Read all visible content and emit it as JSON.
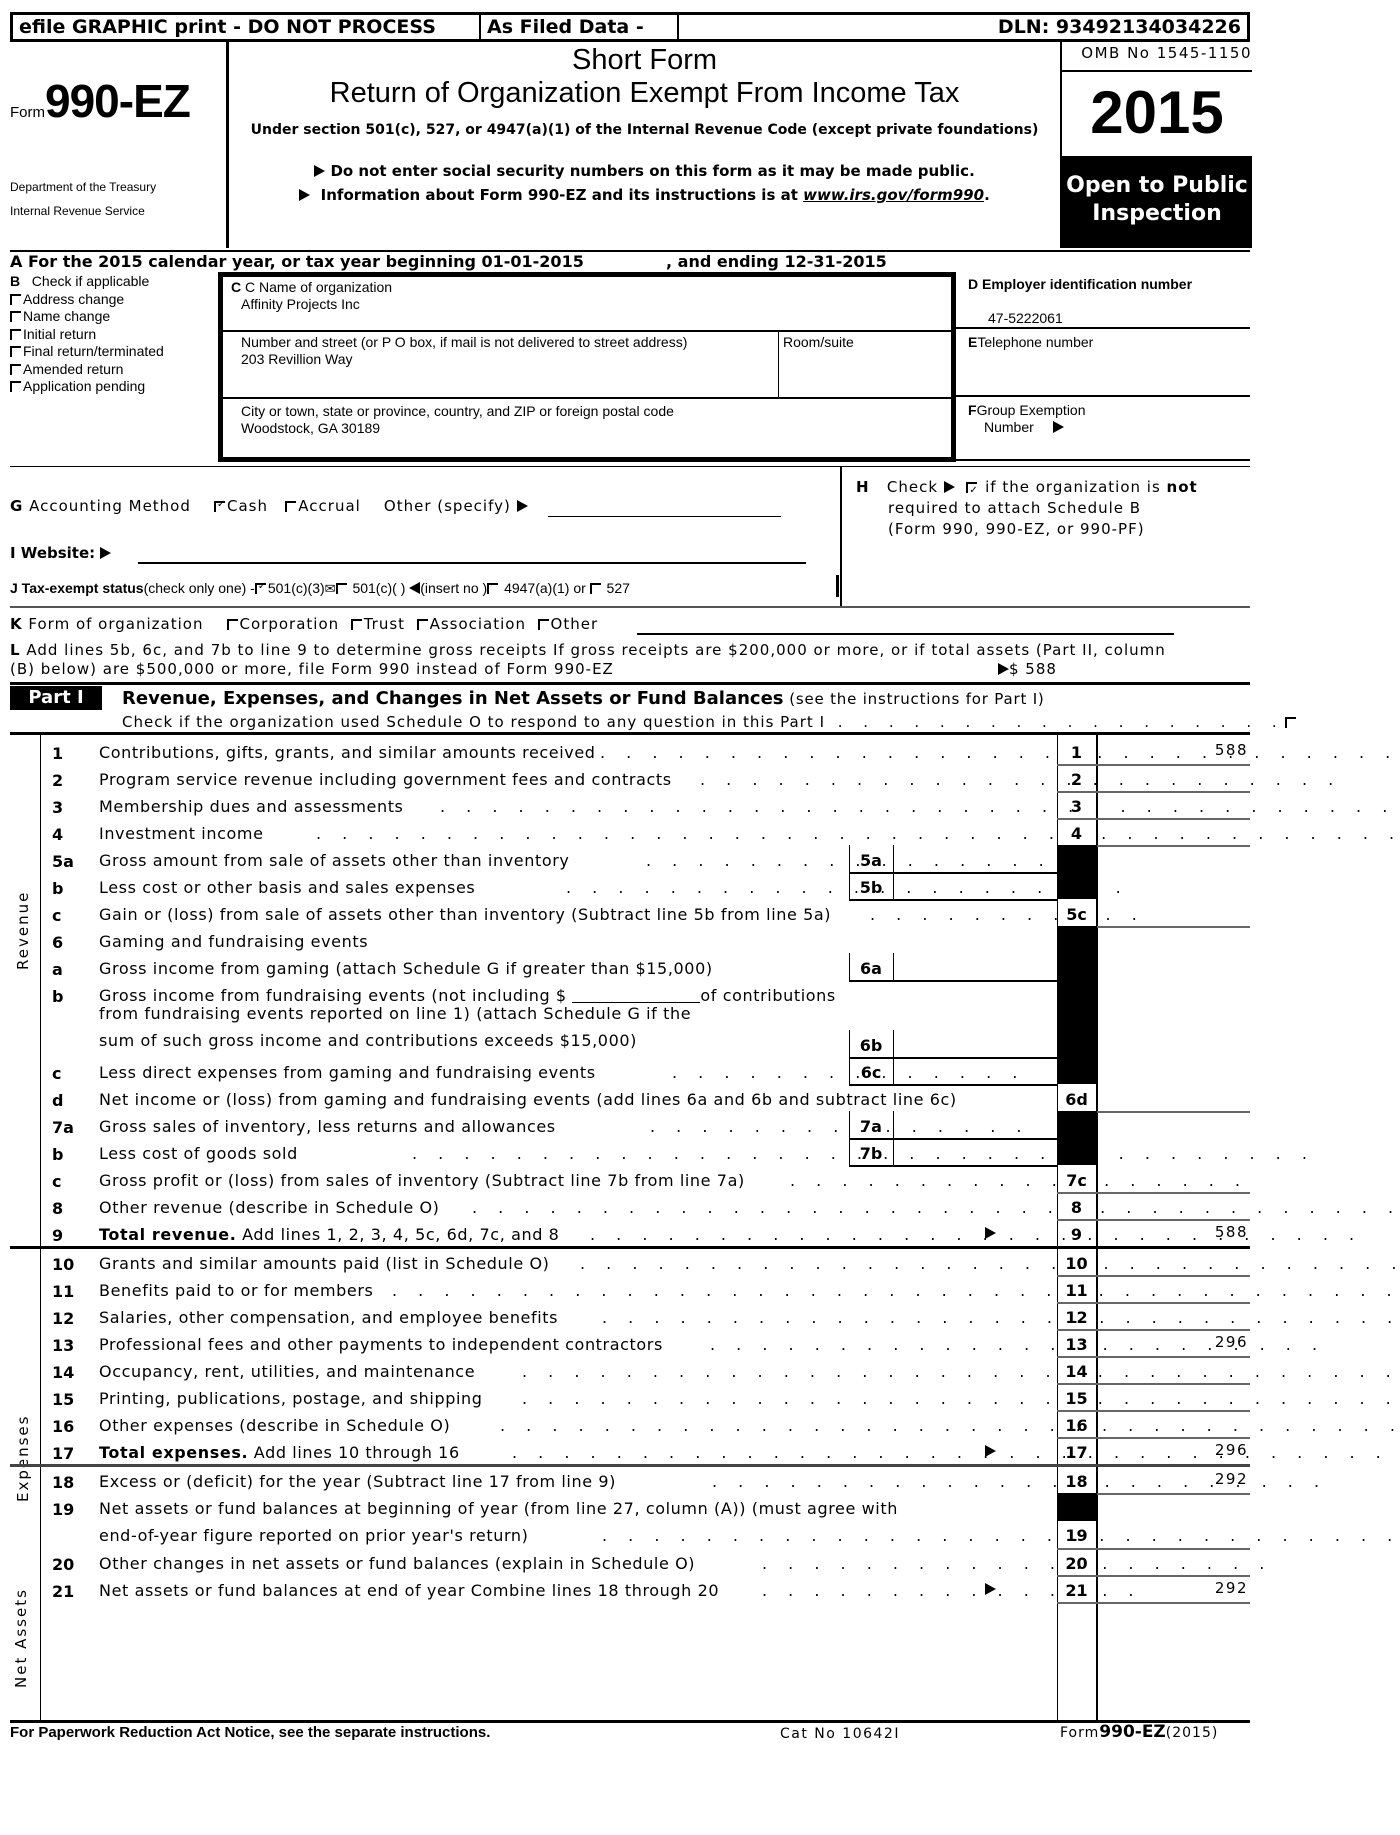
{
  "banner": {
    "efile": "efile GRAPHIC print - DO NOT PROCESS",
    "as_filed": "As Filed Data -",
    "dln": "DLN: 93492134034226"
  },
  "header": {
    "form_prefix": "Form",
    "form_number": "990-EZ",
    "dept1": "Department of the Treasury",
    "dept2": "Internal Revenue Service",
    "short_form": "Short Form",
    "title": "Return of Organization Exempt From Income Tax",
    "subtitle": "Under section 501(c), 527, or 4947(a)(1) of the Internal Revenue Code (except private foundations)",
    "notice1": "Do not enter social security numbers on this form as it may be made public.",
    "notice2_prefix": "Information about Form 990-EZ and its instructions is at ",
    "notice2_link": "www.irs.gov/form990",
    "notice2_suffix": ".",
    "omb": "OMB No 1545-1150",
    "year": "2015",
    "open_public_1": "Open to Public",
    "open_public_2": "Inspection"
  },
  "section_a": {
    "text": "A  For the 2015 calendar year, or tax year beginning 01-01-2015",
    "ending": ", and ending 12-31-2015"
  },
  "section_b": {
    "title_letter": "B",
    "title": "Check if applicable",
    "items": [
      {
        "label": "Address change",
        "checked": false
      },
      {
        "label": "Name change",
        "checked": false
      },
      {
        "label": "Initial return",
        "checked": false
      },
      {
        "label": "Final return/terminated",
        "checked": false
      },
      {
        "label": "Amended return",
        "checked": false
      },
      {
        "label": "Application pending",
        "checked": false
      }
    ]
  },
  "section_c": {
    "name_label": "C Name of organization",
    "name_value": "Affinity Projects Inc",
    "street_label": "Number and street (or P  O  box, if mail is not delivered to street address)",
    "room_label": "Room/suite",
    "street_value": "203 Revillion Way",
    "city_label": "City or town, state or province, country, and ZIP or foreign postal code",
    "city_value": "Woodstock, GA  30189"
  },
  "section_d": {
    "label": "D Employer identification number",
    "value": "47-5222061"
  },
  "section_e": {
    "letter": "E",
    "label": "Telephone number",
    "value": ""
  },
  "section_f": {
    "letter": "F",
    "label1": "Group Exemption",
    "label2": "Number",
    "value": ""
  },
  "section_g": {
    "letter": "G",
    "label": "Accounting Method",
    "cash": "Cash",
    "cash_checked": true,
    "accrual": "Accrual",
    "accrual_checked": false,
    "other": "Other (specify)"
  },
  "section_h": {
    "letter": "H",
    "check": "Check",
    "text1": "if the organization is ",
    "text1_bold": "not",
    "text2": "required to attach Schedule B",
    "text3": "(Form 990, 990-EZ, or 990-PF)",
    "checked": true
  },
  "section_i": {
    "label": "I Website:",
    "value": ""
  },
  "section_j": {
    "label": "J Tax-exempt status",
    "hint": "(check only one) -",
    "opt1": "501(c)(3)",
    "opt2": "501(c)(  )",
    "insert": "(insert no )",
    "opt3": "4947(a)(1) or",
    "opt4": "527"
  },
  "section_k": {
    "letter": "K",
    "label": "Form of organization",
    "options": [
      "Corporation",
      "Trust",
      "Association",
      "Other"
    ]
  },
  "section_l": {
    "letter": "L",
    "text1": "Add lines 5b, 6c, and 7b to line 9 to determine gross receipts  If gross receipts are $200,000 or more, or if total assets (Part II, column",
    "text2": "(B) below) are $500,000 or more, file Form 990 instead of Form 990-EZ",
    "amount": "$ 588"
  },
  "part1": {
    "badge": "Part I",
    "title": "Revenue, Expenses, and Changes in Net Assets or Fund Balances",
    "title_note": "(see the instructions for Part I)",
    "check_text": "Check if the organization used Schedule O to respond to any question in this Part I",
    "side_labels": {
      "revenue": "Revenue",
      "expenses": "Expenses",
      "net_assets": "Net Assets"
    },
    "lines": {
      "l1": {
        "num": "1",
        "label": "Contributions, gifts, grants, and similar amounts received",
        "box": "1",
        "amount": "588"
      },
      "l2": {
        "num": "2",
        "label": "Program service revenue including government fees and contracts",
        "box": "2",
        "amount": ""
      },
      "l3": {
        "num": "3",
        "label": "Membership dues and assessments",
        "box": "3",
        "amount": ""
      },
      "l4": {
        "num": "4",
        "label": "Investment income",
        "box": "4",
        "amount": ""
      },
      "l5a": {
        "num": "5a",
        "label": "Gross amount from sale of assets other than inventory",
        "box": "5a",
        "amount": ""
      },
      "l5b": {
        "num": "b",
        "label": "Less  cost or other basis and sales expenses",
        "box": "5b",
        "amount": ""
      },
      "l5c": {
        "num": "c",
        "label": "Gain or (loss) from sale of assets other than inventory (Subtract line 5b from line 5a)",
        "box": "5c",
        "amount": ""
      },
      "l6": {
        "num": "6",
        "label": "Gaming and fundraising events"
      },
      "l6a": {
        "num": "a",
        "label": "Gross income from gaming (attach Schedule G if greater than $15,000)",
        "box": "6a",
        "amount": ""
      },
      "l6b": {
        "num": "b",
        "label1a": "Gross income from fundraising events (not including $ ",
        "label1b": "of contributions",
        "label2": "from fundraising events reported on line 1) (attach Schedule G if the",
        "label3": "sum of such gross income and contributions exceeds $15,000)",
        "box": "6b",
        "amount": ""
      },
      "l6c": {
        "num": "c",
        "label": "Less  direct expenses from gaming and fundraising events",
        "box": "6c",
        "amount": ""
      },
      "l6d": {
        "num": "d",
        "label": "Net income or (loss) from gaming and fundraising events (add lines 6a and 6b and subtract line 6c)",
        "box": "6d",
        "amount": ""
      },
      "l7a": {
        "num": "7a",
        "label": "Gross sales of inventory, less returns and allowances",
        "box": "7a",
        "amount": ""
      },
      "l7b": {
        "num": "b",
        "label": "Less  cost of goods sold",
        "box": "7b",
        "amount": ""
      },
      "l7c": {
        "num": "c",
        "label": "Gross profit or (loss) from sales of inventory (Subtract line 7b from line 7a)",
        "box": "7c",
        "amount": ""
      },
      "l8": {
        "num": "8",
        "label": "Other revenue (describe in Schedule O)",
        "box": "8",
        "amount": ""
      },
      "l9": {
        "num": "9",
        "label_bold": "Total revenue.",
        "label": " Add lines 1, 2, 3, 4, 5c, 6d, 7c, and 8",
        "box": "9",
        "amount": "588"
      },
      "l10": {
        "num": "10",
        "label": "Grants and similar amounts paid (list in Schedule O)",
        "box": "10",
        "amount": ""
      },
      "l11": {
        "num": "11",
        "label": "Benefits paid to or for members",
        "box": "11",
        "amount": ""
      },
      "l12": {
        "num": "12",
        "label": "Salaries, other compensation, and employee benefits",
        "box": "12",
        "amount": ""
      },
      "l13": {
        "num": "13",
        "label": "Professional fees and other payments to independent contractors",
        "box": "13",
        "amount": "296"
      },
      "l14": {
        "num": "14",
        "label": "Occupancy, rent, utilities, and maintenance",
        "box": "14",
        "amount": ""
      },
      "l15": {
        "num": "15",
        "label": "Printing, publications, postage, and shipping",
        "box": "15",
        "amount": ""
      },
      "l16": {
        "num": "16",
        "label": "Other expenses (describe in Schedule O)",
        "box": "16",
        "amount": ""
      },
      "l17": {
        "num": "17",
        "label_bold": "Total expenses.",
        "label": " Add lines 10 through 16",
        "box": "17",
        "amount": "296"
      },
      "l18": {
        "num": "18",
        "label": "Excess or (deficit) for the year (Subtract line 17 from line 9)",
        "box": "18",
        "amount": "292"
      },
      "l19": {
        "num": "19",
        "label1": "Net assets or fund balances at beginning of year (from line 27, column (A)) (must agree with",
        "label2": "end-of-year figure reported on prior year's return)",
        "box": "19",
        "amount": ""
      },
      "l20": {
        "num": "20",
        "label": "Other changes in net assets or fund balances (explain in Schedule O)",
        "box": "20",
        "amount": ""
      },
      "l21": {
        "num": "21",
        "label": "Net assets or fund balances at end of year  Combine lines 18 through 20",
        "box": "21",
        "amount": "292"
      }
    }
  },
  "footer": {
    "paperwork": "For Paperwork Reduction Act Notice, see the separate instructions.",
    "cat": "Cat No 10642I",
    "form_prefix": "Form",
    "form_number": "990-EZ",
    "form_year": "(2015)"
  }
}
